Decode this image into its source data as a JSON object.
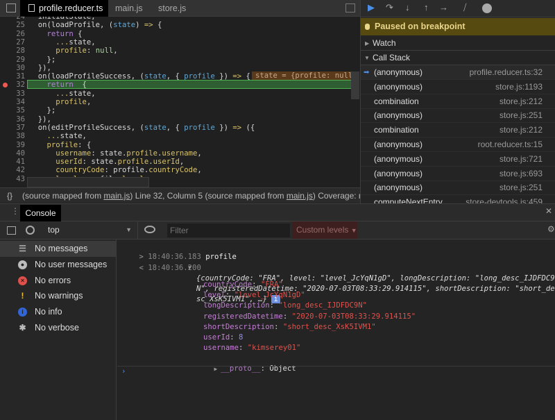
{
  "editor": {
    "tabs": [
      {
        "label": "profile.reducer.ts",
        "active": true,
        "close": "×"
      },
      {
        "label": "main.js"
      },
      {
        "label": "store.js"
      }
    ],
    "lines": [
      {
        "n": "24",
        "t": [
          [
            "  initialState,",
            ""
          ]
        ]
      },
      {
        "n": "25",
        "t": [
          [
            "  on(loadProfile, (",
            ""
          ],
          [
            "state",
            "p"
          ],
          [
            ") ",
            ""
          ],
          [
            "=>",
            "ar"
          ],
          [
            " {",
            ""
          ]
        ]
      },
      {
        "n": "26",
        "t": [
          [
            "    ",
            ""
          ],
          [
            "return",
            "k"
          ],
          [
            " {",
            ""
          ]
        ]
      },
      {
        "n": "27",
        "t": [
          [
            "      ",
            ""
          ],
          [
            "...",
            "y"
          ],
          [
            "state,",
            ""
          ]
        ]
      },
      {
        "n": "28",
        "t": [
          [
            "      ",
            ""
          ],
          [
            "profile",
            "y"
          ],
          [
            ": ",
            ""
          ],
          [
            "null",
            "n"
          ],
          [
            ",",
            ""
          ]
        ]
      },
      {
        "n": "29",
        "t": [
          [
            "    };",
            ""
          ]
        ]
      },
      {
        "n": "30",
        "t": [
          [
            "  }),",
            ""
          ]
        ]
      },
      {
        "n": "31",
        "t": [
          [
            "  on(loadProfileSuccess, (",
            ""
          ],
          [
            "state",
            "p"
          ],
          [
            ", { ",
            ""
          ],
          [
            "profile",
            "p"
          ],
          [
            " }) ",
            ""
          ],
          [
            "=>",
            "ar"
          ],
          [
            " {",
            ""
          ]
        ]
      },
      {
        "n": "32",
        "t": [
          [
            "    ",
            ""
          ],
          [
            "return",
            "k"
          ],
          [
            "  {",
            ""
          ]
        ],
        "breakpoint": true,
        "current": true
      },
      {
        "n": "33",
        "t": [
          [
            "      ",
            ""
          ],
          [
            "...",
            "y"
          ],
          [
            "state,",
            ""
          ]
        ]
      },
      {
        "n": "34",
        "t": [
          [
            "      ",
            ""
          ],
          [
            "profile",
            "y"
          ],
          [
            ",",
            ""
          ]
        ]
      },
      {
        "n": "35",
        "t": [
          [
            "    };",
            ""
          ]
        ]
      },
      {
        "n": "36",
        "t": [
          [
            "  }),",
            ""
          ]
        ]
      },
      {
        "n": "37",
        "t": [
          [
            "  on(editProfileSuccess, (",
            ""
          ],
          [
            "state",
            "p"
          ],
          [
            ", { ",
            ""
          ],
          [
            "profile",
            "p"
          ],
          [
            " }) ",
            ""
          ],
          [
            "=>",
            "ar"
          ],
          [
            " ({",
            ""
          ]
        ]
      },
      {
        "n": "38",
        "t": [
          [
            "    ",
            ""
          ],
          [
            "...",
            "y"
          ],
          [
            "state,",
            ""
          ]
        ]
      },
      {
        "n": "39",
        "t": [
          [
            "    ",
            ""
          ],
          [
            "profile",
            "y"
          ],
          [
            ": {",
            ""
          ]
        ]
      },
      {
        "n": "40",
        "t": [
          [
            "      ",
            ""
          ],
          [
            "username",
            "y"
          ],
          [
            ": state.",
            ""
          ],
          [
            "profile",
            "y"
          ],
          [
            ".",
            ""
          ],
          [
            "username",
            "y"
          ],
          [
            ",",
            ""
          ]
        ]
      },
      {
        "n": "41",
        "t": [
          [
            "      ",
            ""
          ],
          [
            "userId",
            "y"
          ],
          [
            ": state.",
            ""
          ],
          [
            "profile",
            "y"
          ],
          [
            ".",
            ""
          ],
          [
            "userId",
            "y"
          ],
          [
            ",",
            ""
          ]
        ]
      },
      {
        "n": "42",
        "t": [
          [
            "      ",
            ""
          ],
          [
            "countryCode",
            "y"
          ],
          [
            ": profile.",
            ""
          ],
          [
            "countryCode",
            "y"
          ],
          [
            ",",
            ""
          ]
        ]
      },
      {
        "n": "43",
        "t": [
          [
            "      ",
            ""
          ],
          [
            "level",
            "y"
          ],
          [
            ": profile.",
            ""
          ],
          [
            "level",
            "y"
          ],
          [
            ",",
            ""
          ]
        ]
      }
    ],
    "inline_value": "state = {profile: null",
    "status": {
      "braces": "{}",
      "p1": "(source mapped from ",
      "link1": "main.js",
      "p2": ") Line 32, Column 5 (source mapped from ",
      "link2": "main.js",
      "p3": ") Coverage: n/a"
    }
  },
  "debugger": {
    "paused": "Paused on breakpoint",
    "watch": "Watch",
    "call_stack": "Call Stack",
    "frames": [
      {
        "fn": "(anonymous)",
        "loc": "profile.reducer.ts:32",
        "current": true
      },
      {
        "fn": "(anonymous)",
        "loc": "store.js:1193"
      },
      {
        "fn": "combination",
        "loc": "store.js:212"
      },
      {
        "fn": "(anonymous)",
        "loc": "store.js:251"
      },
      {
        "fn": "combination",
        "loc": "store.js:212"
      },
      {
        "fn": "(anonymous)",
        "loc": "root.reducer.ts:15"
      },
      {
        "fn": "(anonymous)",
        "loc": "store.js:721"
      },
      {
        "fn": "(anonymous)",
        "loc": "store.js:693"
      },
      {
        "fn": "(anonymous)",
        "loc": "store.js:251"
      },
      {
        "fn": "computeNextEntry",
        "loc": "store-devtools.js:459"
      }
    ]
  },
  "console": {
    "tab": "Console",
    "context": "top",
    "filter_placeholder": "Filter",
    "levels": "Custom levels",
    "sidebar": [
      {
        "label": "No messages",
        "icon": "list-icon",
        "color": "#aaaaaa"
      },
      {
        "label": "No user messages",
        "icon": "user-icon",
        "color": "#bbbbbb"
      },
      {
        "label": "No errors",
        "icon": "error-icon",
        "color": "#e0504a"
      },
      {
        "label": "No warnings",
        "icon": "warning-icon",
        "color": "#f2c230"
      },
      {
        "label": "No info",
        "icon": "info-icon",
        "color": "#3066d8"
      },
      {
        "label": "No verbose",
        "icon": "bug-icon",
        "color": "#bbbbbb"
      }
    ],
    "input_ts": "18:40:36.183",
    "input": "profile",
    "output_ts": "18:40:36.200",
    "summary1": "{countryCode: \"FRA\", level: \"level_JcYqN1gD\", longDescription: \"long_desc_IJDFDC9",
    "summary2": "N\", registeredDatetime: \"2020-07-03T08:33:29.914115\", shortDescription: \"short_de",
    "summary3": "sc_XsK5IVM1\", …}",
    "props": [
      {
        "k": "countryCode",
        "v": "\"FRA\""
      },
      {
        "k": "level",
        "v": "\"level_JcYqN1gD\""
      },
      {
        "k": "longDescription",
        "v": "\"long_desc_IJDFDC9N\""
      },
      {
        "k": "registeredDatetime",
        "v": "\"2020-07-03T08:33:29.914115\""
      },
      {
        "k": "shortDescription",
        "v": "\"short_desc_XsK5IVM1\""
      },
      {
        "k": "userId",
        "v": "8",
        "num": true
      },
      {
        "k": "username",
        "v": "\"kimserey01\""
      }
    ],
    "proto_key": "__proto__",
    "proto_val": "Object"
  }
}
